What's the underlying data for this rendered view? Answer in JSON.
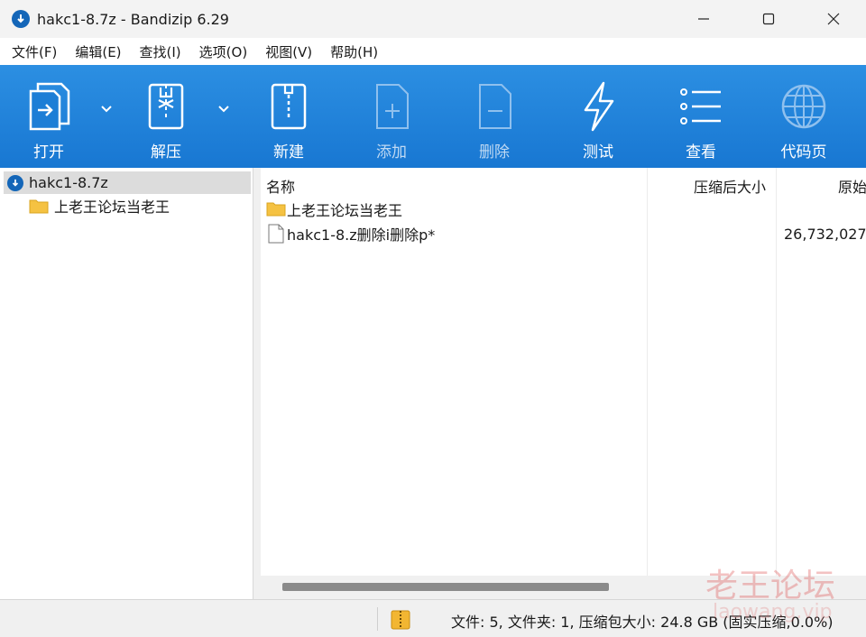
{
  "window": {
    "title": "hakc1-8.7z - Bandizip 6.29",
    "app_icon": "bandizip-logo-icon",
    "controls": [
      "minimize-icon",
      "maximize-icon",
      "close-icon"
    ]
  },
  "menu": [
    {
      "label": "文件(F)"
    },
    {
      "label": "编辑(E)"
    },
    {
      "label": "查找(I)"
    },
    {
      "label": "选项(O)"
    },
    {
      "label": "视图(V)"
    },
    {
      "label": "帮助(H)"
    }
  ],
  "toolbar": {
    "colors": {
      "background": "#1877d2",
      "icon": "#ffffff",
      "disabled_icon": "#8fc0ee"
    },
    "items": [
      {
        "label": "打开",
        "icon": "open-archive-icon",
        "enabled": true,
        "has_dropdown": true
      },
      {
        "label": "解压",
        "icon": "extract-icon",
        "enabled": true,
        "has_dropdown": true
      },
      {
        "label": "新建",
        "icon": "new-archive-icon",
        "enabled": true,
        "has_dropdown": false
      },
      {
        "label": "添加",
        "icon": "add-file-icon",
        "enabled": false,
        "has_dropdown": false
      },
      {
        "label": "删除",
        "icon": "delete-file-icon",
        "enabled": false,
        "has_dropdown": false
      },
      {
        "label": "测试",
        "icon": "test-lightning-icon",
        "enabled": true,
        "has_dropdown": false
      },
      {
        "label": "查看",
        "icon": "view-list-icon",
        "enabled": true,
        "has_dropdown": false
      },
      {
        "label": "代码页",
        "icon": "codepage-globe-icon",
        "enabled": true,
        "has_dropdown": false
      }
    ]
  },
  "tree": {
    "root": {
      "label": "hakc1-8.7z",
      "icon": "bandizip-logo-icon",
      "selected": true
    },
    "children": [
      {
        "label": "上老王论坛当老王",
        "icon": "folder-icon"
      }
    ]
  },
  "list": {
    "columns": [
      {
        "label": "名称"
      },
      {
        "label": "压缩后大小"
      },
      {
        "label": "原始"
      }
    ],
    "rows": [
      {
        "name": "上老王论坛当老王",
        "icon": "folder-icon",
        "packed": "",
        "original": ""
      },
      {
        "name": "hakc1-8.z删除i删除p*",
        "icon": "file-icon",
        "packed": "",
        "original": "26,732,027"
      }
    ]
  },
  "status": {
    "icon": "archive-zip-icon",
    "text": "文件: 5, 文件夹: 1, 压缩包大小: 24.8 GB (固实压缩,0.0%)"
  },
  "watermark": {
    "text": "老王论坛",
    "subtext": "laowang.vip"
  }
}
